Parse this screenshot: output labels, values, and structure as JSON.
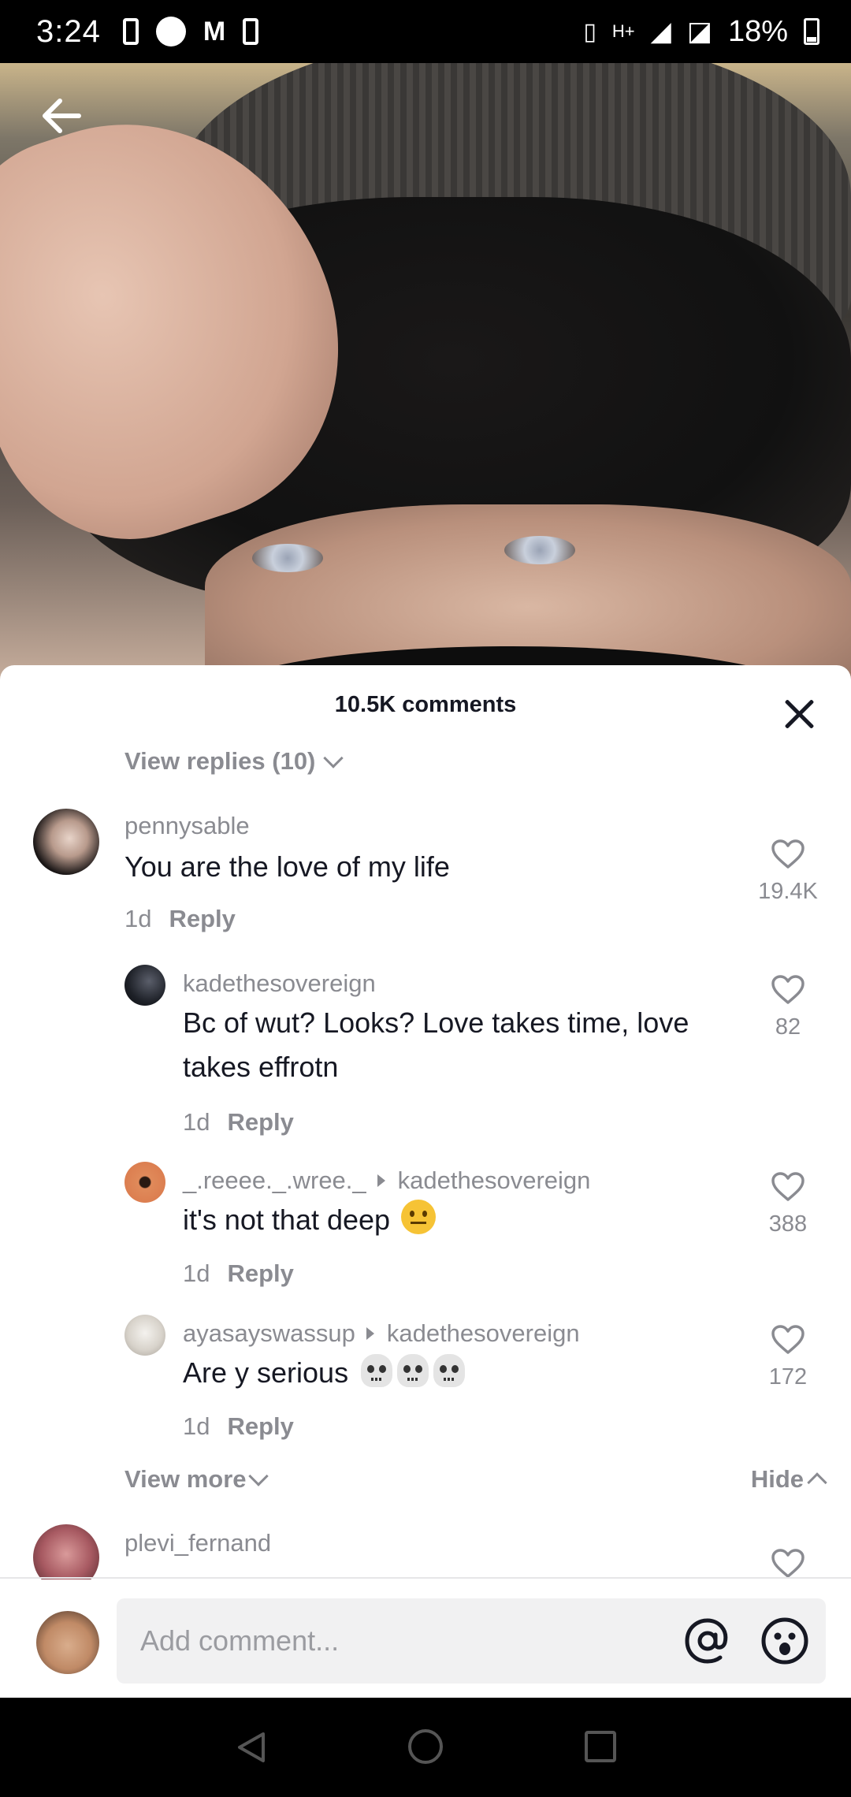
{
  "status_bar": {
    "time": "3:24",
    "battery": "18%",
    "network": "H+"
  },
  "sheet": {
    "title": "10.5K comments",
    "view_replies": "View replies (10)"
  },
  "comments": [
    {
      "username": "pennysable",
      "reply_to": "",
      "text": "You are the love of my life",
      "age": "1d",
      "reply_label": "Reply",
      "likes": "19.4K"
    },
    {
      "username": "kadethesovereign",
      "reply_to": "",
      "text": "Bc of wut? Looks? Love takes time, love takes effrotn",
      "age": "1d",
      "reply_label": "Reply",
      "likes": "82"
    },
    {
      "username": "_.reeee._.wree._",
      "reply_to": "kadethesovereign",
      "text": "it's not that deep",
      "age": "1d",
      "reply_label": "Reply",
      "likes": "388",
      "emoji": "neutral-face"
    },
    {
      "username": "ayasayswassup",
      "reply_to": "kadethesovereign",
      "text": "Are y serious",
      "age": "1d",
      "reply_label": "Reply",
      "likes": "172",
      "emoji": "skull x3"
    },
    {
      "username": "plevi_fernand",
      "reply_to": "",
      "text": "",
      "likes": ""
    }
  ],
  "thread_controls": {
    "view_more": "View more",
    "hide": "Hide"
  },
  "composer": {
    "placeholder": "Add comment..."
  },
  "icons": [
    "back-arrow-icon",
    "close-icon",
    "heart-icon",
    "at-icon",
    "emoji-icon",
    "chevron-down-icon",
    "chevron-up-icon"
  ]
}
